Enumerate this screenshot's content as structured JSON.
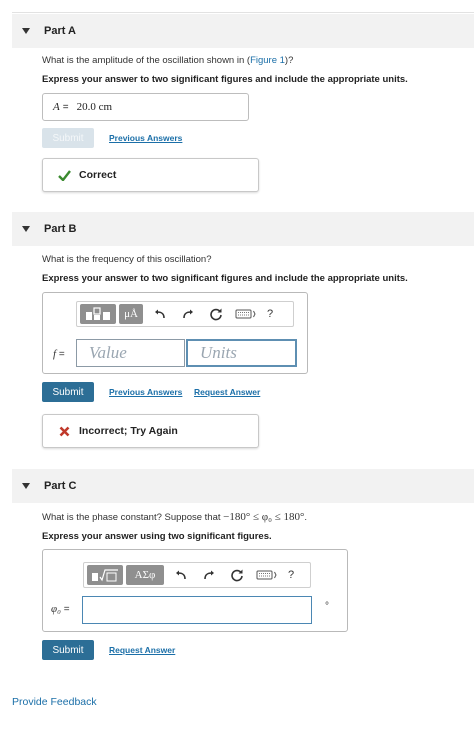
{
  "part_a": {
    "title": "Part A",
    "question_prefix": "What is the amplitude of the oscillation shown in (",
    "figure_link": "Figure 1",
    "question_suffix": ")?",
    "instruction": "Express your answer to two significant figures and include the appropriate units.",
    "answer_var": "A",
    "answer_eq": "=",
    "answer_value": "20.0 cm",
    "submit_label": "Submit",
    "previous_answers": "Previous Answers",
    "feedback": "Correct"
  },
  "part_b": {
    "title": "Part B",
    "question": "What is the frequency of this oscillation?",
    "instruction": "Express your answer to two significant figures and include the appropriate units.",
    "toolbar_units_label": "μÅ",
    "toolbar_help": "?",
    "var_label": "f",
    "eq": "=",
    "value_placeholder": "Value",
    "units_placeholder": "Units",
    "submit_label": "Submit",
    "previous_answers": "Previous Answers",
    "request_answer": "Request Answer",
    "feedback": "Incorrect; Try Again"
  },
  "part_c": {
    "title": "Part C",
    "question_prefix": "What is the phase constant? Suppose that ",
    "question_math": "−180° ≤ φ₀ ≤ 180°",
    "question_suffix": ".",
    "instruction": "Express your answer using two significant figures.",
    "toolbar_greek_label": "ΑΣφ",
    "toolbar_help": "?",
    "var_label": "φ₀",
    "eq": "=",
    "unit_suffix": "°",
    "submit_label": "Submit",
    "request_answer": "Request Answer"
  },
  "footer": {
    "provide_feedback": "Provide Feedback"
  },
  "colors": {
    "link": "#1b6fa8",
    "submit": "#2c6e96",
    "correct": "#3a8a2e",
    "incorrect": "#c0392b"
  }
}
